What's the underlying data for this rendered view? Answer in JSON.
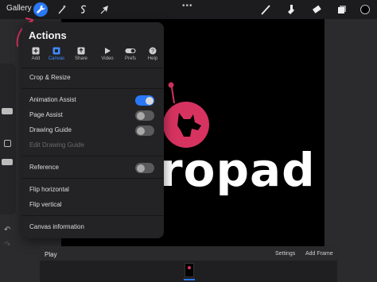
{
  "topbar": {
    "gallery_label": "Gallery",
    "left_tools": [
      "wrench-icon",
      "magic-wand-icon",
      "selection-s-icon",
      "arrow-cursor-icon"
    ],
    "right_tools": [
      "brush-icon",
      "smudge-icon",
      "eraser-icon",
      "layers-icon"
    ],
    "more_label": "•••"
  },
  "canvas": {
    "text": "ropad",
    "logo_color": "#d63360",
    "background": "#000000"
  },
  "sidebar": {
    "undo_icon": "↶",
    "redo_icon": "↷"
  },
  "actions": {
    "title": "Actions",
    "tabs": [
      {
        "label": "Add",
        "icon": "plus-icon"
      },
      {
        "label": "Canvas",
        "icon": "canvas-icon",
        "active": true
      },
      {
        "label": "Share",
        "icon": "share-icon"
      },
      {
        "label": "Video",
        "icon": "play-icon"
      },
      {
        "label": "Prefs",
        "icon": "toggle-icon"
      },
      {
        "label": "Help",
        "icon": "help-icon"
      }
    ],
    "items": {
      "crop_resize": "Crop & Resize",
      "animation_assist": "Animation Assist",
      "page_assist": "Page Assist",
      "drawing_guide": "Drawing Guide",
      "edit_drawing_guide": "Edit Drawing Guide",
      "reference": "Reference",
      "flip_horizontal": "Flip horizontal",
      "flip_vertical": "Flip vertical",
      "canvas_information": "Canvas information"
    },
    "toggles": {
      "animation_assist": true,
      "page_assist": false,
      "drawing_guide": false,
      "reference": false
    }
  },
  "timeline": {
    "play_label": "Play",
    "settings_label": "Settings",
    "add_frame_label": "Add Frame"
  },
  "colors": {
    "accent": "#2a78f6",
    "annotation": "#d63360"
  }
}
